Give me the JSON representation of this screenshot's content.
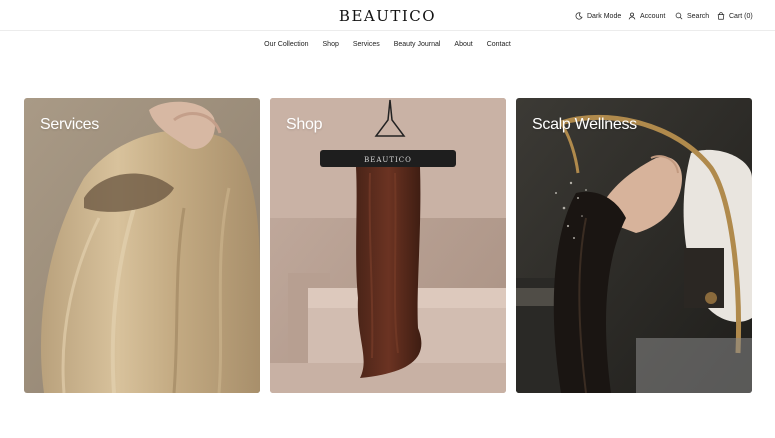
{
  "header": {
    "brand": "BEAUTICO",
    "utilities": {
      "dark_mode": "Dark Mode",
      "account": "Account",
      "search": "Search",
      "cart": "Cart (0)"
    }
  },
  "nav": {
    "items": [
      "Our Collection",
      "Shop",
      "Services",
      "Beauty Journal",
      "About",
      "Contact"
    ]
  },
  "cards": [
    {
      "title": "Services",
      "icon": "hair-extension-photo"
    },
    {
      "title": "Shop",
      "icon": "hanging-hair-extension-photo",
      "hanger_label": "BEAUTICO"
    },
    {
      "title": "Scalp Wellness",
      "icon": "hair-wash-photo"
    }
  ]
}
